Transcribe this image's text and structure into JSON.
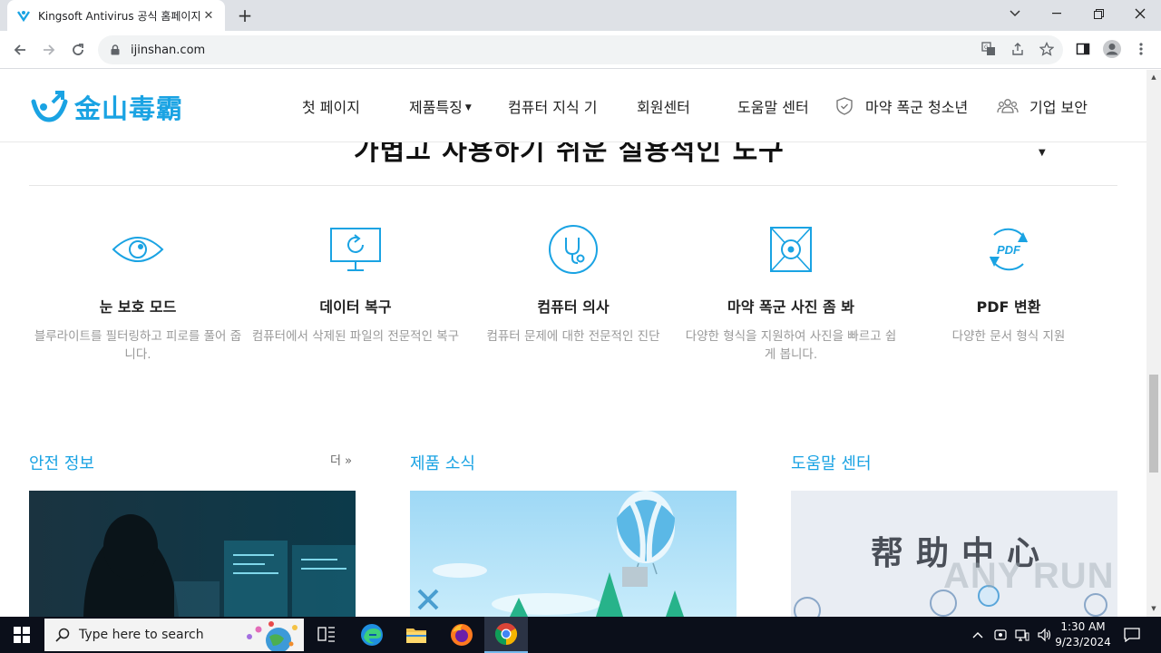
{
  "browser": {
    "tab_title": "Kingsoft Antivirus 공식 홈페이지",
    "url": "ijinshan.com"
  },
  "header": {
    "logo_text": "金山毒霸",
    "nav": [
      {
        "label": "첫 페이지"
      },
      {
        "label": "제품특징"
      },
      {
        "label": "컴퓨터 지식 기"
      },
      {
        "label": "회원센터"
      },
      {
        "label": "도움말 센터"
      },
      {
        "label": "마약 폭군 청소년"
      },
      {
        "label": "기업 보안"
      }
    ]
  },
  "tools": {
    "heading": "가볍고 사용하기 쉬운 실용적인 도구",
    "items": [
      {
        "name": "눈 보호 모드",
        "desc": "블루라이트를 필터링하고 피로를 풀어 줍니다.",
        "icon": "eye-icon"
      },
      {
        "name": "데이터 복구",
        "desc": "컴퓨터에서 삭제된 파일의 전문적인 복구",
        "icon": "monitor-restore-icon"
      },
      {
        "name": "컴퓨터 의사",
        "desc": "컴퓨터 문제에 대한 전문적인 진단",
        "icon": "stethoscope-icon"
      },
      {
        "name": "마약 폭군 사진 좀 봐",
        "desc": "다양한 형식을 지원하여 사진을 빠르고 쉽게 봅니다.",
        "icon": "photo-viewer-icon"
      },
      {
        "name": "PDF 변환",
        "desc": "다양한 문서 형식 지원",
        "icon": "pdf-convert-icon"
      }
    ]
  },
  "sections": {
    "security": {
      "title": "안전 정보",
      "more": "더"
    },
    "product": {
      "title": "제품 소식"
    },
    "help": {
      "title": "도움말 센터",
      "banner_text": "帮助中心"
    }
  },
  "watermark": "ANY RUN",
  "taskbar": {
    "search_placeholder": "Type here to search",
    "time": "1:30 AM",
    "date": "9/23/2024"
  },
  "colors": {
    "accent": "#1aa3e3",
    "taskbar": "#0b0f1a"
  }
}
